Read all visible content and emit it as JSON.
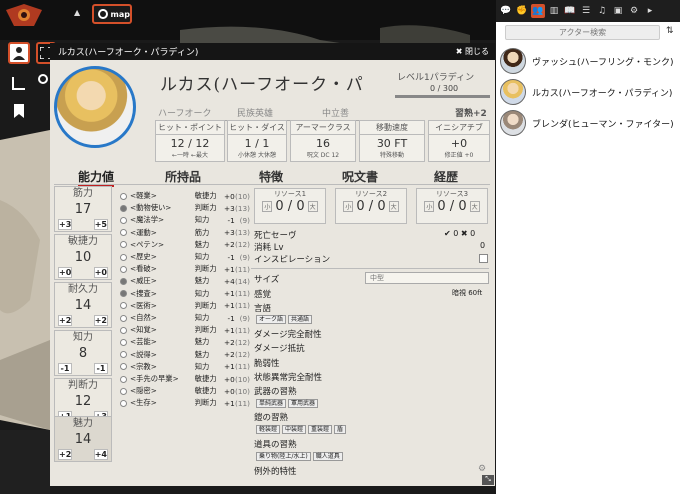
{
  "topbar": {
    "map_label": "map"
  },
  "dialog": {
    "title": "ルカス(ハーフオーク・パラディン)",
    "close_label": "閉じる",
    "char_name": "ルカス(ハーフオーク・パ",
    "level_class": "レベル1パラディン",
    "xp": "0 / 300",
    "race": "ハーフオーク",
    "background": "民族英雄",
    "alignment": "中立善",
    "proficiency": "習熟+2",
    "stats": [
      {
        "head": "ヒット・ポイント",
        "value": "12 / 12",
        "foot": "←一時     ←最大"
      },
      {
        "head": "ヒット・ダイス",
        "value": "1 / 1",
        "foot": "小休憩   大休憩"
      },
      {
        "head": "アーマークラス",
        "value": "16",
        "foot": "呪文 DC 12"
      },
      {
        "head": "移動速度",
        "value": "30 FT",
        "foot": "特殊移動"
      },
      {
        "head": "イニシアチブ",
        "value": "+0",
        "foot": "修正値   +0"
      }
    ],
    "tabs": [
      "能力値",
      "所持品",
      "特徴",
      "呪文書",
      "経歴"
    ],
    "abilities": [
      {
        "name": "筋力",
        "score": "17",
        "mod": "+3",
        "save": "+5"
      },
      {
        "name": "敏捷力",
        "score": "10",
        "mod": "+0",
        "save": "+0"
      },
      {
        "name": "耐久力",
        "score": "14",
        "mod": "+2",
        "save": "+2"
      },
      {
        "name": "知力",
        "score": "8",
        "mod": "-1",
        "save": "-1"
      },
      {
        "name": "判断力",
        "score": "12",
        "mod": "+1",
        "save": "+3"
      },
      {
        "name": "魅力",
        "score": "14",
        "mod": "+2",
        "save": "+4"
      }
    ],
    "skills": [
      {
        "name": "<軽業>",
        "ab": "敏捷力",
        "val": "+0",
        "pas": "(10)",
        "on": false
      },
      {
        "name": "<動物使い>",
        "ab": "判断力",
        "val": "+3",
        "pas": "(13)",
        "on": true
      },
      {
        "name": "<魔法学>",
        "ab": "知力",
        "val": "-1",
        "pas": "(9)",
        "on": false
      },
      {
        "name": "<運動>",
        "ab": "筋力",
        "val": "+3",
        "pas": "(13)",
        "on": false
      },
      {
        "name": "<ペテン>",
        "ab": "魅力",
        "val": "+2",
        "pas": "(12)",
        "on": false
      },
      {
        "name": "<歴史>",
        "ab": "知力",
        "val": "-1",
        "pas": "(9)",
        "on": false
      },
      {
        "name": "<看破>",
        "ab": "判断力",
        "val": "+1",
        "pas": "(11)",
        "on": false
      },
      {
        "name": "<威圧>",
        "ab": "魅力",
        "val": "+4",
        "pas": "(14)",
        "on": true
      },
      {
        "name": "<捜査>",
        "ab": "知力",
        "val": "+1",
        "pas": "(11)",
        "on": true
      },
      {
        "name": "<医術>",
        "ab": "判断力",
        "val": "+1",
        "pas": "(11)",
        "on": false
      },
      {
        "name": "<自然>",
        "ab": "知力",
        "val": "-1",
        "pas": "(9)",
        "on": false
      },
      {
        "name": "<知覚>",
        "ab": "判断力",
        "val": "+1",
        "pas": "(11)",
        "on": false
      },
      {
        "name": "<芸能>",
        "ab": "魅力",
        "val": "+2",
        "pas": "(12)",
        "on": false
      },
      {
        "name": "<説得>",
        "ab": "魅力",
        "val": "+2",
        "pas": "(12)",
        "on": false
      },
      {
        "name": "<宗教>",
        "ab": "知力",
        "val": "+1",
        "pas": "(11)",
        "on": false
      },
      {
        "name": "<手先の早業>",
        "ab": "敏捷力",
        "val": "+0",
        "pas": "(10)",
        "on": false
      },
      {
        "name": "<隠密>",
        "ab": "敏捷力",
        "val": "+0",
        "pas": "(10)",
        "on": false
      },
      {
        "name": "<生存>",
        "ab": "判断力",
        "val": "+1",
        "pas": "(11)",
        "on": false
      }
    ],
    "resources": [
      {
        "title": "リソース1",
        "value": "0 / 0",
        "small": "小",
        "big": "大"
      },
      {
        "title": "リソース2",
        "value": "0 / 0",
        "small": "小",
        "big": "大"
      },
      {
        "title": "リソース3",
        "value": "0 / 0",
        "small": "小",
        "big": "大"
      }
    ],
    "death_saves": "死亡セーヴ",
    "death_marks": "✔ 0  ✖ 0",
    "exhaustion": "消耗 Lv",
    "exhaustion_val": "0",
    "inspiration": "インスピレーション",
    "size_label": "サイズ",
    "size_value": "中型",
    "senses": "感覚",
    "senses_value": "暗視 60ft",
    "languages": "言語",
    "language_tags": [
      "オーク語",
      "共通語"
    ],
    "props": [
      "ダメージ完全耐性",
      "ダメージ抵抗",
      "脆弱性",
      "状態異常完全耐性"
    ],
    "weapon_prof": "武器の習熟",
    "weapon_tags": [
      "単純武器",
      "軍用武器"
    ],
    "armor_prof": "鎧の習熟",
    "armor_tags": [
      "軽装鎧",
      "中装鎧",
      "重装鎧",
      "盾"
    ],
    "tool_prof": "道具の習熟",
    "tool_tags": [
      "乗り物(陸上/水上)",
      "職人道具"
    ],
    "special": "例外的特性"
  },
  "sidebar": {
    "search_placeholder": "アクター検索",
    "actors": [
      {
        "name": "ヴァッシュ(ハーフリング・モンク)"
      },
      {
        "name": "ルカス(ハーフオーク・パラディン)"
      },
      {
        "name": "ブレンダ(ヒューマン・ファイター)"
      }
    ]
  }
}
